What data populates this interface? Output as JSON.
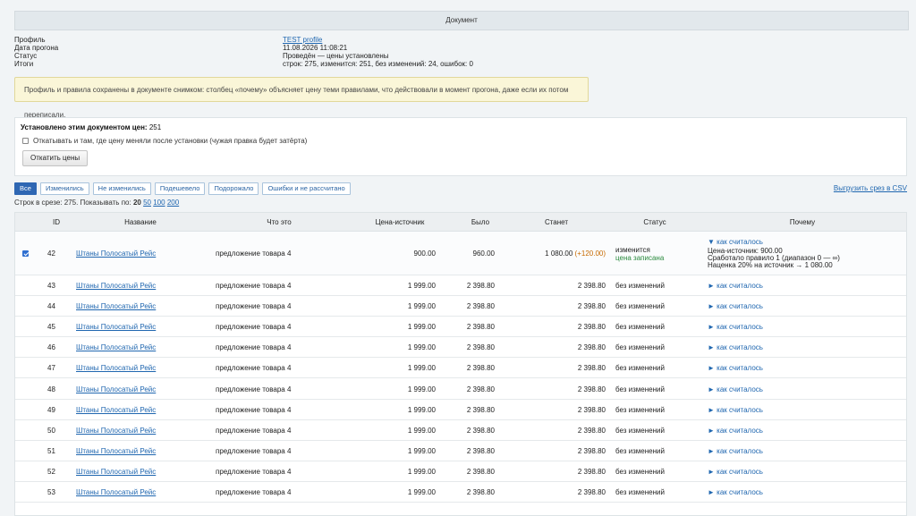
{
  "title": "Документ",
  "info": [
    {
      "label": "Профиль",
      "value": "TEST profile",
      "link": true
    },
    {
      "label": "Дата прогона",
      "value": "11.08.2026 11:08:21"
    },
    {
      "label": "Статус",
      "value": "Проведён — цены установлены"
    },
    {
      "label": "Итоги",
      "value": "строк: 275, изменится: 251, без изменений: 24, ошибок: 0"
    }
  ],
  "notice": "Профиль и правила сохранены в документе снимком: столбец «почему» объясняет цену теми правилами, что действовали в момент прогона, даже если их потом переписали.",
  "panel": {
    "title_bold": "Установлено этим документом цен:",
    "title_count": "251",
    "checkbox_label": "Откатывать и там, где цену меняли после установки (чужая правка будет затёрта)",
    "rollback_button": "Откатить цены"
  },
  "filters": [
    "Все",
    "Изменились",
    "Не изменились",
    "Подешевело",
    "Подорожало",
    "Ошибки и не рассчитано"
  ],
  "export_link": "Выгрузить срез в CSV",
  "pager": {
    "slice_text": "Строк в срезе: 275.",
    "page_label": "Показывать по:",
    "current": "20",
    "options": [
      "50",
      "100",
      "200"
    ]
  },
  "columns": [
    "ID",
    "Название",
    "Что это",
    "Цена-источник",
    "Было",
    "Станет",
    "Статус",
    "Почему"
  ],
  "rows": [
    {
      "id": "42",
      "name": "Штаны Полосатый Рейс",
      "what": "предложение товара 4",
      "src": "900.00",
      "was": "960.00",
      "will": "1 080.00",
      "delta": "(+120.00)",
      "status": "изменится",
      "status2": "цена записана",
      "why": "▼ как считалось",
      "calc": [
        "Цена-источник: 900.00",
        "Сработало правило 1 (диапазон 0 — ∞)",
        "Наценка 20% на источник → 1 080.00"
      ],
      "checked": true
    },
    {
      "id": "43",
      "name": "Штаны Полосатый Рейс",
      "what": "предложение товара 4",
      "src": "1 999.00",
      "was": "2 398.80",
      "will": "2 398.80",
      "status": "без изменений",
      "why": "► как считалось"
    },
    {
      "id": "44",
      "name": "Штаны Полосатый Рейс",
      "what": "предложение товара 4",
      "src": "1 999.00",
      "was": "2 398.80",
      "will": "2 398.80",
      "status": "без изменений",
      "why": "► как считалось"
    },
    {
      "id": "45",
      "name": "Штаны Полосатый Рейс",
      "what": "предложение товара 4",
      "src": "1 999.00",
      "was": "2 398.80",
      "will": "2 398.80",
      "status": "без изменений",
      "why": "► как считалось"
    },
    {
      "id": "46",
      "name": "Штаны Полосатый Рейс",
      "what": "предложение товара 4",
      "src": "1 999.00",
      "was": "2 398.80",
      "will": "2 398.80",
      "status": "без изменений",
      "why": "► как считалось"
    },
    {
      "id": "47",
      "name": "Штаны Полосатый Рейс",
      "what": "предложение товара 4",
      "src": "1 999.00",
      "was": "2 398.80",
      "will": "2 398.80",
      "status": "без изменений",
      "why": "► как считалось"
    },
    {
      "id": "48",
      "name": "Штаны Полосатый Рейс",
      "what": "предложение товара 4",
      "src": "1 999.00",
      "was": "2 398.80",
      "will": "2 398.80",
      "status": "без изменений",
      "why": "► как считалось"
    },
    {
      "id": "49",
      "name": "Штаны Полосатый Рейс",
      "what": "предложение товара 4",
      "src": "1 999.00",
      "was": "2 398.80",
      "will": "2 398.80",
      "status": "без изменений",
      "why": "► как считалось"
    },
    {
      "id": "50",
      "name": "Штаны Полосатый Рейс",
      "what": "предложение товара 4",
      "src": "1 999.00",
      "was": "2 398.80",
      "will": "2 398.80",
      "status": "без изменений",
      "why": "► как считалось"
    },
    {
      "id": "51",
      "name": "Штаны Полосатый Рейс",
      "what": "предложение товара 4",
      "src": "1 999.00",
      "was": "2 398.80",
      "will": "2 398.80",
      "status": "без изменений",
      "why": "► как считалось"
    },
    {
      "id": "52",
      "name": "Штаны Полосатый Рейс",
      "what": "предложение товара 4",
      "src": "1 999.00",
      "was": "2 398.80",
      "will": "2 398.80",
      "status": "без изменений",
      "why": "► как считалось"
    },
    {
      "id": "53",
      "name": "Штаны Полосатый Рейс",
      "what": "предложение товара 4",
      "src": "1 999.00",
      "was": "2 398.80",
      "will": "2 398.80",
      "status": "без изменений",
      "why": "► как считалось"
    }
  ]
}
